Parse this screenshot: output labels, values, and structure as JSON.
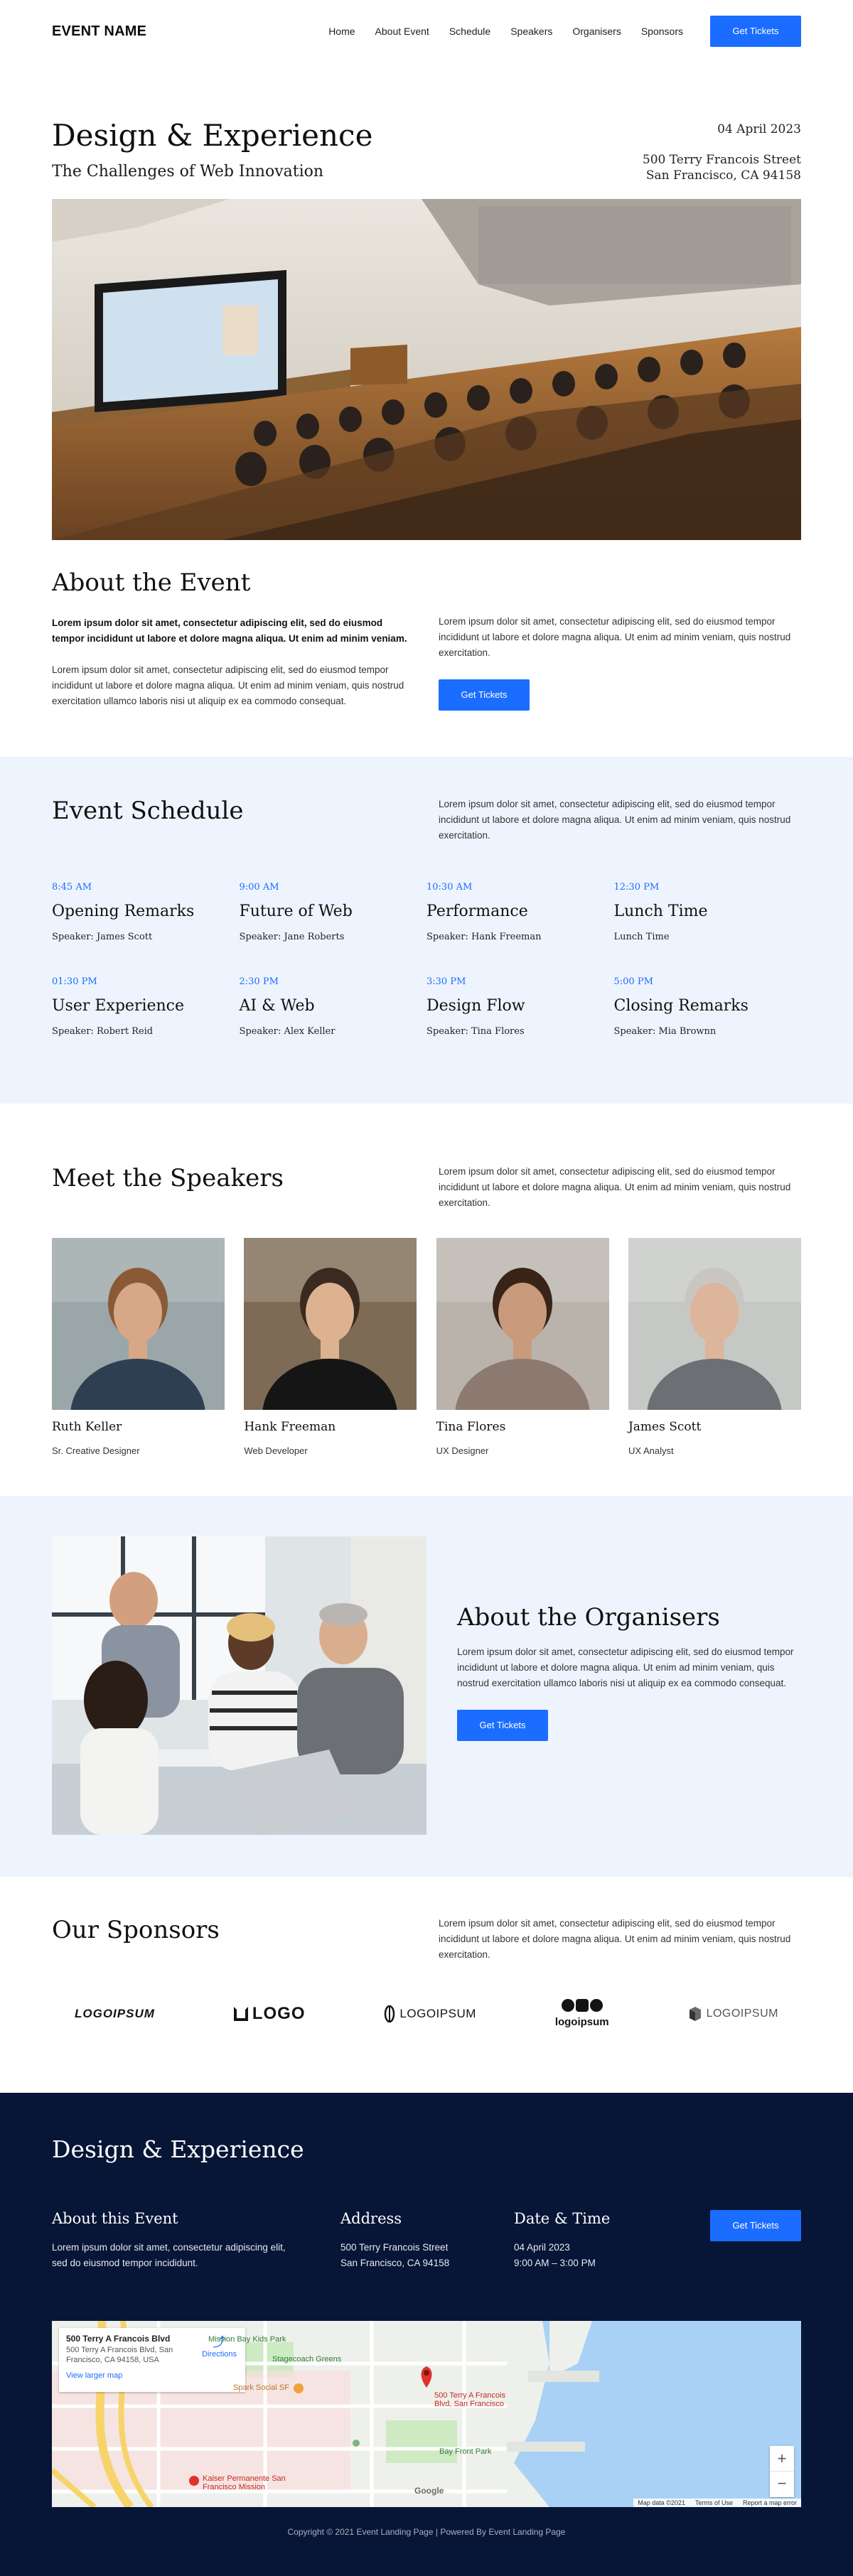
{
  "nav": {
    "brand": "EVENT NAME",
    "items": [
      "Home",
      "About Event",
      "Schedule",
      "Speakers",
      "Organisers",
      "Sponsors"
    ],
    "cta": "Get Tickets"
  },
  "hero": {
    "title": "Design & Experience",
    "subtitle": "The Challenges of Web Innovation",
    "date": "04 April 2023",
    "address_line1": "500 Terry Francois Street",
    "address_line2": "San Francisco, CA 94158"
  },
  "about": {
    "title": "About the Event",
    "bold_text": "Lorem ipsum dolor sit amet, consectetur adipiscing elit, sed do eiusmod tempor incididunt ut labore et dolore magna aliqua. Ut enim ad minim veniam.",
    "left_text": "Lorem ipsum dolor sit amet, consectetur adipiscing elit, sed do eiusmod tempor incididunt ut labore et dolore magna aliqua. Ut enim ad minim veniam, quis nostrud exercitation ullamco laboris nisi ut aliquip ex ea commodo consequat.",
    "right_text": "Lorem ipsum dolor sit amet, consectetur adipiscing elit, sed do eiusmod tempor incididunt ut labore et dolore magna aliqua. Ut enim ad minim veniam, quis nostrud exercitation.",
    "cta": "Get Tickets"
  },
  "schedule": {
    "title": "Event Schedule",
    "intro": "Lorem ipsum dolor sit amet, consectetur adipiscing elit, sed do eiusmod tempor incididunt ut labore et dolore magna aliqua. Ut enim ad minim veniam, quis nostrud exercitation.",
    "items": [
      {
        "time": "8:45 AM",
        "title": "Opening Remarks",
        "speaker": "Speaker: James Scott"
      },
      {
        "time": "9:00 AM",
        "title": "Future of Web",
        "speaker": "Speaker: Jane Roberts"
      },
      {
        "time": "10:30 AM",
        "title": "Performance",
        "speaker": "Speaker: Hank Freeman"
      },
      {
        "time": "12:30 PM",
        "title": "Lunch Time",
        "speaker": "Lunch Time"
      },
      {
        "time": "01:30 PM",
        "title": "User Experience",
        "speaker": "Speaker: Robert Reid"
      },
      {
        "time": "2:30 PM",
        "title": "AI & Web",
        "speaker": "Speaker: Alex Keller"
      },
      {
        "time": "3:30 PM",
        "title": "Design Flow",
        "speaker": "Speaker: Tina Flores"
      },
      {
        "time": "5:00 PM",
        "title": "Closing Remarks",
        "speaker": "Speaker: Mia Brownn"
      }
    ]
  },
  "speakers": {
    "title": "Meet the Speakers",
    "intro": "Lorem ipsum dolor sit amet, consectetur adipiscing elit, sed do eiusmod tempor incididunt ut labore et dolore magna aliqua. Ut enim ad minim veniam, quis nostrud exercitation.",
    "people": [
      {
        "name": "Ruth Keller",
        "role": "Sr. Creative Designer"
      },
      {
        "name": "Hank Freeman",
        "role": "Web Developer"
      },
      {
        "name": "Tina Flores",
        "role": "UX Designer"
      },
      {
        "name": "James Scott",
        "role": "UX Analyst"
      }
    ]
  },
  "organisers": {
    "title": "About the Organisers",
    "text": "Lorem ipsum dolor sit amet, consectetur adipiscing elit, sed do eiusmod tempor incididunt ut labore et dolore magna aliqua. Ut enim ad minim veniam, quis nostrud exercitation ullamco laboris nisi ut aliquip ex ea commodo consequat.",
    "cta": "Get Tickets"
  },
  "sponsors": {
    "title": "Our Sponsors",
    "intro": "Lorem ipsum dolor sit amet, consectetur adipiscing elit, sed do eiusmod tempor incididunt ut labore et dolore magna aliqua. Ut enim ad minim veniam, quis nostrud exercitation.",
    "logos": [
      "LOGOIPSUM",
      "LOGO",
      "LOGOIPSUM",
      "logoipsum",
      "LOGOIPSUM"
    ]
  },
  "footer": {
    "title": "Design & Experience",
    "about_title": "About this Event",
    "about_text": "Lorem ipsum dolor sit amet, consectetur adipiscing elit, sed do eiusmod tempor incididunt.",
    "address_title": "Address",
    "address_line1": "500 Terry Francois Street",
    "address_line2": "San Francisco, CA 94158",
    "date_title": "Date & Time",
    "date": "04 April 2023",
    "time": "9:00 AM – 3:00 PM",
    "cta": "Get Tickets",
    "copyright": "Copyright © 2021 Event Landing Page | Powered By Event Landing Page"
  },
  "map": {
    "card_title": "500 Terry A Francois Blvd",
    "card_address_line1": "500 Terry A Francois Blvd, San",
    "card_address_line2": "Francisco, CA 94158, USA",
    "directions": "Directions",
    "larger_map": "View larger map",
    "pin_label_line1": "500 Terry A Francois",
    "pin_label_line2": "Blvd, San Francisco",
    "labels": [
      "Mission Bay Kids Park",
      "Stagecoach Greens",
      "Spark Social SF",
      "Bay Front Park",
      "Kaiser Permanente San Francisco Mission",
      "Google"
    ],
    "attribution": [
      "Map data ©2021",
      "Terms of Use",
      "Report a map error"
    ],
    "zoom_in": "+",
    "zoom_out": "−",
    "colors": {
      "water": "#a9d1f5",
      "land": "#eef0ec",
      "park": "#cdeac2",
      "highway": "#f7d46b",
      "pin": "#e0322b"
    }
  },
  "colors": {
    "accent": "#1a6dff",
    "light_bg": "#eef4fe",
    "footer_bg": "#071536"
  }
}
